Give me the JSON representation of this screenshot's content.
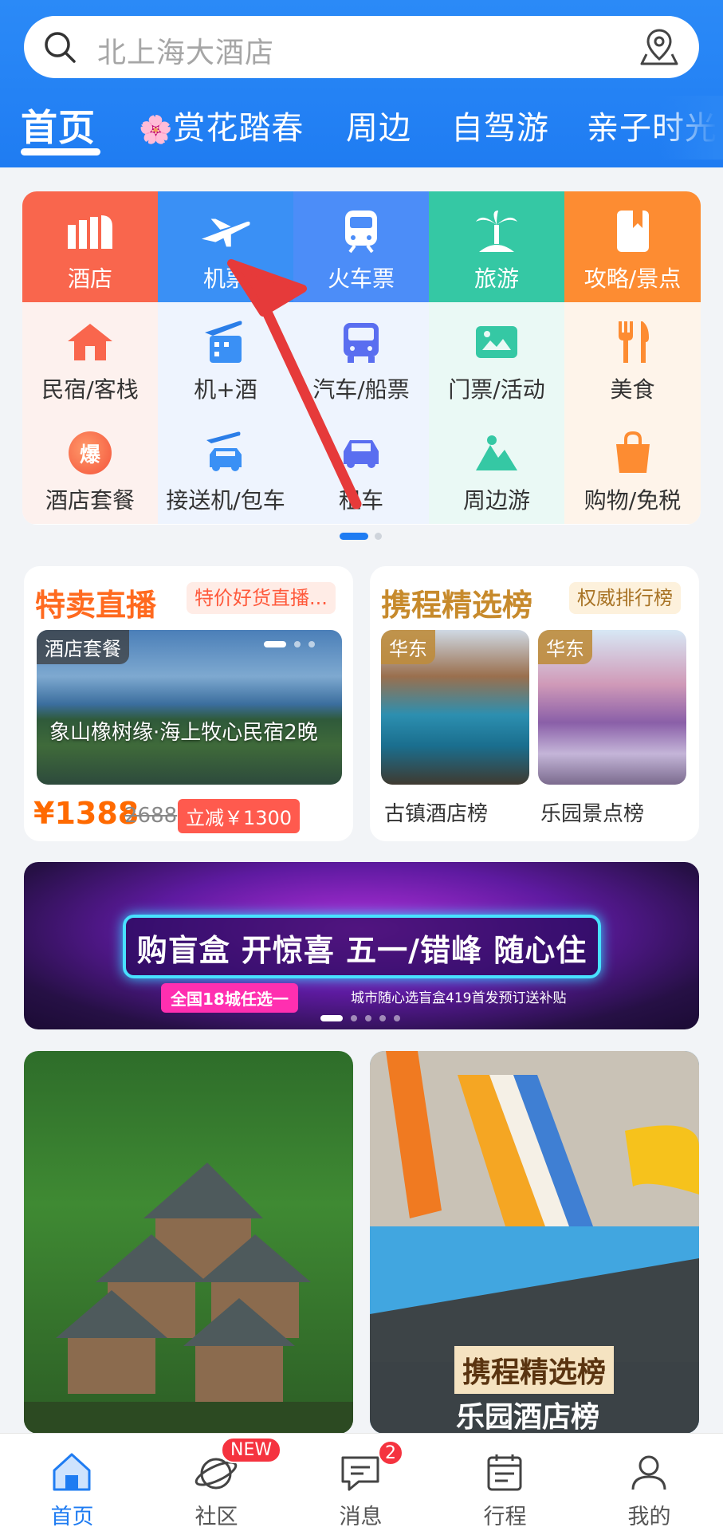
{
  "search": {
    "placeholder": "北上海大酒店"
  },
  "tabs": [
    {
      "label": "首页",
      "active": true
    },
    {
      "label": "赏花踏春",
      "emoji": "🌸"
    },
    {
      "label": "周边"
    },
    {
      "label": "自驾游"
    },
    {
      "label": "亲子时光"
    }
  ],
  "grid": {
    "row1": [
      "酒店",
      "机票",
      "火车票",
      "旅游",
      "攻略/景点"
    ],
    "row2": [
      "民宿/客栈",
      "机+酒",
      "汽车/船票",
      "门票/活动",
      "美食"
    ],
    "row3": [
      "酒店套餐",
      "接送机/包车",
      "租车",
      "周边游",
      "购物/免税"
    ],
    "row1_colors": [
      "#f9664d",
      "#3a90f5",
      "#4c8df8",
      "#35c8a4",
      "#fd8c32"
    ],
    "explode_char": "爆"
  },
  "deals": {
    "left": {
      "title": "特卖直播",
      "pill": "特价好货直播...",
      "tag": "酒店套餐",
      "caption": "象山橡树缘·海上牧心民宿2晚",
      "price": "¥1388",
      "old_price": "2688",
      "discount": "立减￥1300"
    },
    "right": {
      "title": "携程精选榜",
      "pill": "权威排行榜",
      "items": [
        {
          "tag": "华东",
          "label": "古镇酒店榜"
        },
        {
          "tag": "华东",
          "label": "乐园景点榜"
        }
      ]
    }
  },
  "banner": {
    "title": "购盲盒 开惊喜 五一/错峰 随心住",
    "sub1": "全国18城任选一",
    "sub2": "城市随心选盲盒419首发预订送补贴"
  },
  "photos": {
    "right_label1": "携程精选榜",
    "right_label2": "乐园酒店榜"
  },
  "nav": {
    "items": [
      "首页",
      "社区",
      "消息",
      "行程",
      "我的"
    ],
    "badge_new": "NEW",
    "badge_count": "2"
  }
}
